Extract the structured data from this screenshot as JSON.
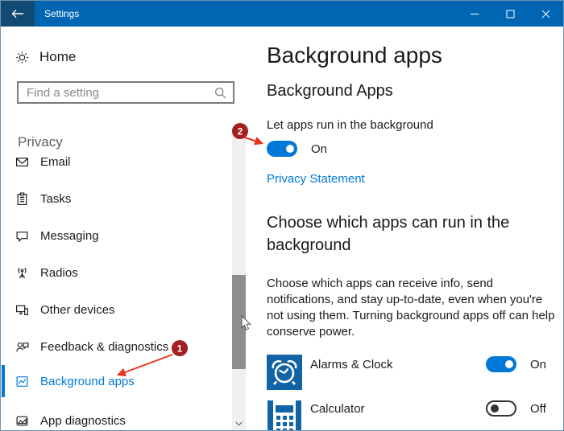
{
  "titlebar": {
    "title": "Settings"
  },
  "sidebar": {
    "home_label": "Home",
    "search_placeholder": "Find a setting",
    "section_label": "Privacy",
    "items": [
      {
        "label": "Email",
        "icon": "email-icon",
        "selected": false
      },
      {
        "label": "Tasks",
        "icon": "tasks-icon",
        "selected": false
      },
      {
        "label": "Messaging",
        "icon": "messaging-icon",
        "selected": false
      },
      {
        "label": "Radios",
        "icon": "radios-icon",
        "selected": false
      },
      {
        "label": "Other devices",
        "icon": "other-devices-icon",
        "selected": false
      },
      {
        "label": "Feedback & diagnostics",
        "icon": "feedback-icon",
        "selected": false
      },
      {
        "label": "Background apps",
        "icon": "background-apps-icon",
        "selected": true
      },
      {
        "label": "App diagnostics",
        "icon": "app-diagnostics-icon",
        "selected": false
      }
    ]
  },
  "main": {
    "page_title": "Background apps",
    "background_apps": {
      "heading": "Background Apps",
      "toggle_label": "Let apps run in the background",
      "toggle_state": "On",
      "privacy_link": "Privacy Statement"
    },
    "choose": {
      "heading": "Choose which apps can run in the background",
      "description": "Choose which apps can receive info, send notifications, and stay up-to-date, even when you're not using them. Turning background apps off can help conserve power."
    },
    "apps": [
      {
        "name": "Alarms & Clock",
        "state": "On",
        "enabled": true
      },
      {
        "name": "Calculator",
        "state": "Off",
        "enabled": false
      }
    ]
  },
  "annotations": {
    "step1": "1",
    "step2": "2"
  },
  "colors": {
    "accent": "#0078d7",
    "titlebar": "#0065b3",
    "back_button": "#114a73",
    "badge_red": "#a32020",
    "arrow_red": "#e8321f",
    "alarm_tile_blue": "#1163a5"
  }
}
